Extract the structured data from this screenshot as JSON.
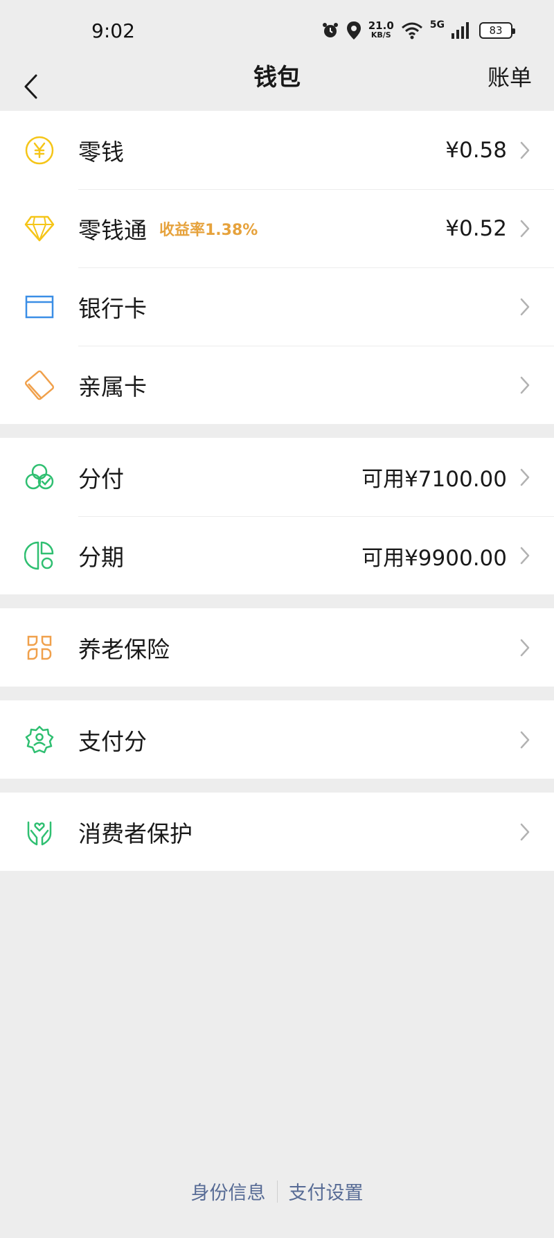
{
  "status_bar": {
    "time": "9:02",
    "speed_value": "21.0",
    "speed_unit": "KB/S",
    "network": "5G",
    "battery": "83"
  },
  "nav": {
    "title": "钱包",
    "action": "账单"
  },
  "colors": {
    "yellow": "#f5c518",
    "blue": "#3a8ee6",
    "orange": "#f0a04b",
    "green": "#2fbf71",
    "link": "#576b95",
    "tag": "#e6a23c"
  },
  "groups": [
    {
      "items": [
        {
          "label": "零钱",
          "icon": "yuan-coin-icon",
          "value": "¥0.58"
        },
        {
          "label": "零钱通",
          "icon": "diamond-icon",
          "tag": "收益率1.38%",
          "value": "¥0.52"
        },
        {
          "label": "银行卡",
          "icon": "bank-card-icon"
        },
        {
          "label": "亲属卡",
          "icon": "family-card-icon"
        }
      ]
    },
    {
      "items": [
        {
          "label": "分付",
          "icon": "fenfu-icon",
          "value": "可用¥7100.00"
        },
        {
          "label": "分期",
          "icon": "installment-icon",
          "value": "可用¥9900.00"
        }
      ]
    },
    {
      "items": [
        {
          "label": "养老保险",
          "icon": "pension-icon"
        }
      ]
    },
    {
      "items": [
        {
          "label": "支付分",
          "icon": "pay-score-icon"
        }
      ]
    },
    {
      "items": [
        {
          "label": "消费者保护",
          "icon": "consumer-protection-icon"
        }
      ]
    }
  ],
  "footer": {
    "identity": "身份信息",
    "settings": "支付设置"
  }
}
